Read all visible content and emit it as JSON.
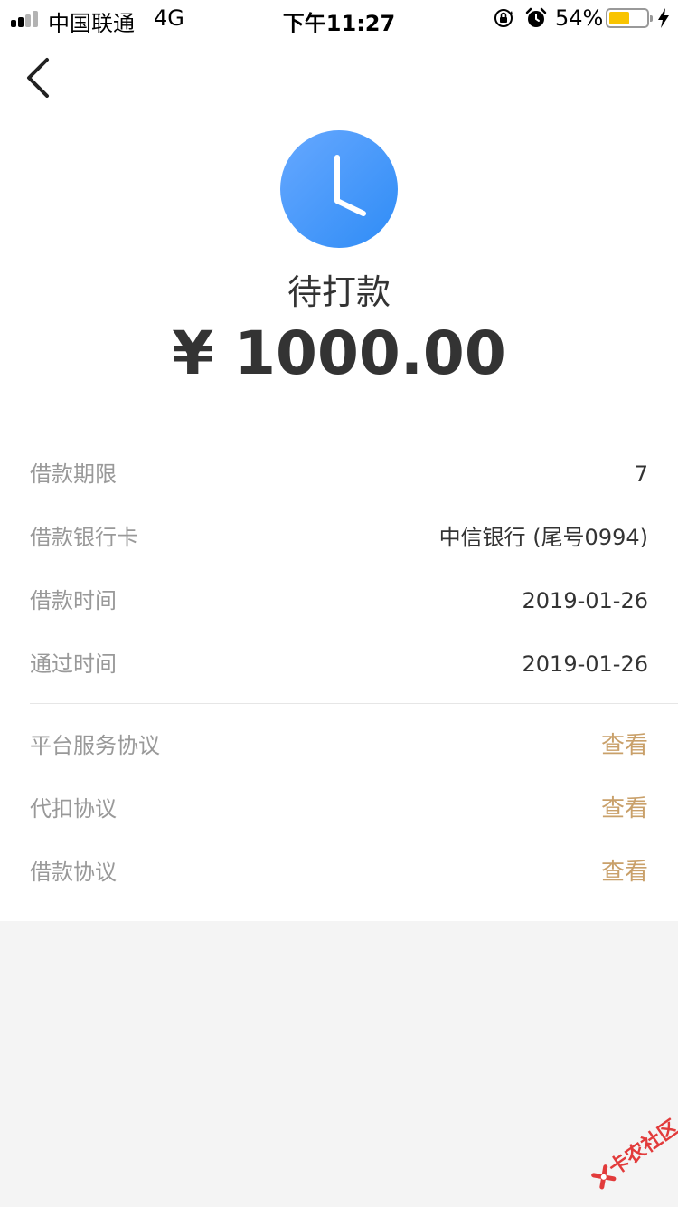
{
  "status_bar": {
    "carrier": "中国联通",
    "network": "4G",
    "time": "下午11:27",
    "battery_percent_text": "54%",
    "battery_level": 0.54,
    "icons": [
      "signal-icon",
      "orientation-lock-icon",
      "alarm-icon",
      "battery-icon",
      "charging-bolt-icon"
    ]
  },
  "header": {
    "back_icon": "chevron-left-icon"
  },
  "status": {
    "icon": "clock-icon",
    "title": "待打款",
    "amount": "¥ 1000.00"
  },
  "details": [
    {
      "label": "借款期限",
      "value": "7"
    },
    {
      "label": "借款银行卡",
      "value": "中信银行 (尾号0994)"
    },
    {
      "label": "借款时间",
      "value": "2019-01-26"
    },
    {
      "label": "通过时间",
      "value": "2019-01-26"
    }
  ],
  "agreements": [
    {
      "label": "平台服务协议",
      "action": "查看"
    },
    {
      "label": "代扣协议",
      "action": "查看"
    },
    {
      "label": "借款协议",
      "action": "查看"
    }
  ],
  "watermark": {
    "text": "卡农社区"
  },
  "colors": {
    "primary_text": "#333333",
    "label_text": "#999999",
    "link": "#c9a06a",
    "clock_blue": "#3d93fa",
    "page_background": "#f4f4f4",
    "battery_fill": "#f9c400",
    "watermark_red": "#e23b3b"
  }
}
